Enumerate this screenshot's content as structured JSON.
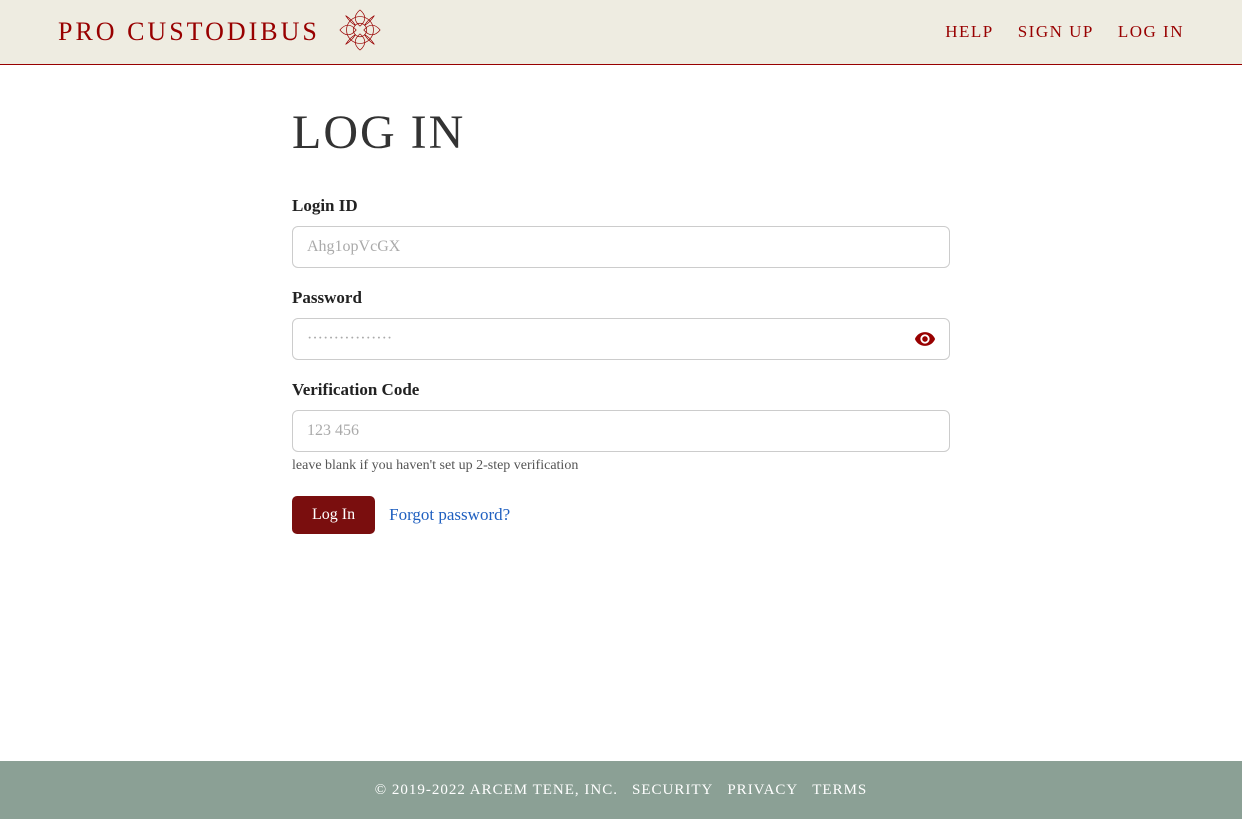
{
  "header": {
    "brand": "PRO CUSTODIBUS",
    "nav": {
      "help": "HELP",
      "signup": "SIGN UP",
      "login": "LOG IN"
    }
  },
  "main": {
    "title": "LOG IN",
    "login_id": {
      "label": "Login ID",
      "placeholder": "Ahg1opVcGX",
      "value": ""
    },
    "password": {
      "label": "Password",
      "placeholder": "················",
      "value": ""
    },
    "verification": {
      "label": "Verification Code",
      "placeholder": "123 456",
      "value": "",
      "help": "leave blank if you haven't set up 2-step verification"
    },
    "submit_label": "Log In",
    "forgot_label": "Forgot password?"
  },
  "footer": {
    "copyright": "© 2019-2022 ARCEM TENE, INC.",
    "security": "SECURITY",
    "privacy": "PRIVACY",
    "terms": "TERMS"
  }
}
